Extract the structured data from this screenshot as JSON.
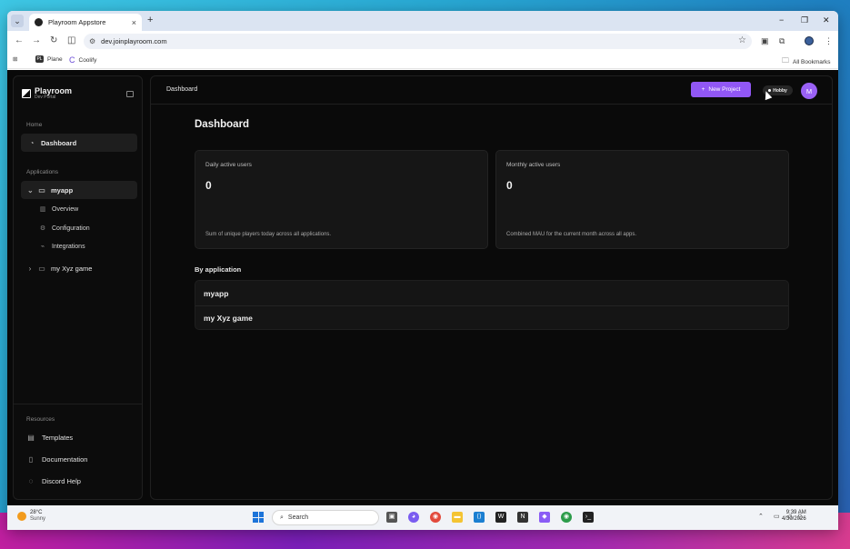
{
  "browser": {
    "tab_title": "Playroom Appstore",
    "url": "dev.joinplayroom.com",
    "bookmarks": [
      "Plane",
      "Coolify"
    ],
    "all_bookmarks": "All Bookmarks"
  },
  "sidebar": {
    "logo_name": "Playroom",
    "logo_sub": "Dev Portal",
    "home_label": "Home",
    "dashboard": "Dashboard",
    "applications_label": "Applications",
    "apps": [
      {
        "name": "myapp",
        "expanded": true,
        "children": [
          "Overview",
          "Configuration",
          "Integrations"
        ]
      },
      {
        "name": "my Xyz game",
        "expanded": false
      }
    ],
    "resources_label": "Resources",
    "resources": [
      "Templates",
      "Documentation",
      "Discord Help"
    ]
  },
  "header": {
    "breadcrumb": "Dashboard",
    "new_project": "New Project",
    "plan": "Hobby",
    "avatar_initial": "M"
  },
  "main": {
    "title": "Dashboard",
    "cards": [
      {
        "label": "Daily active users",
        "value": "0",
        "desc": "Sum of unique players today across all applications."
      },
      {
        "label": "Monthly active users",
        "value": "0",
        "desc": "Combined MAU for the current month across all apps."
      }
    ],
    "by_application_label": "By application",
    "applications": [
      "myapp",
      "my Xyz game"
    ]
  },
  "taskbar": {
    "temp": "28°C",
    "weather": "Sunny",
    "search_placeholder": "Search",
    "time": "9:39 AM",
    "date": "4/30/2026"
  },
  "colors": {
    "accent": "#9157f5",
    "app_bg": "#090909",
    "card_bg": "#161616"
  }
}
